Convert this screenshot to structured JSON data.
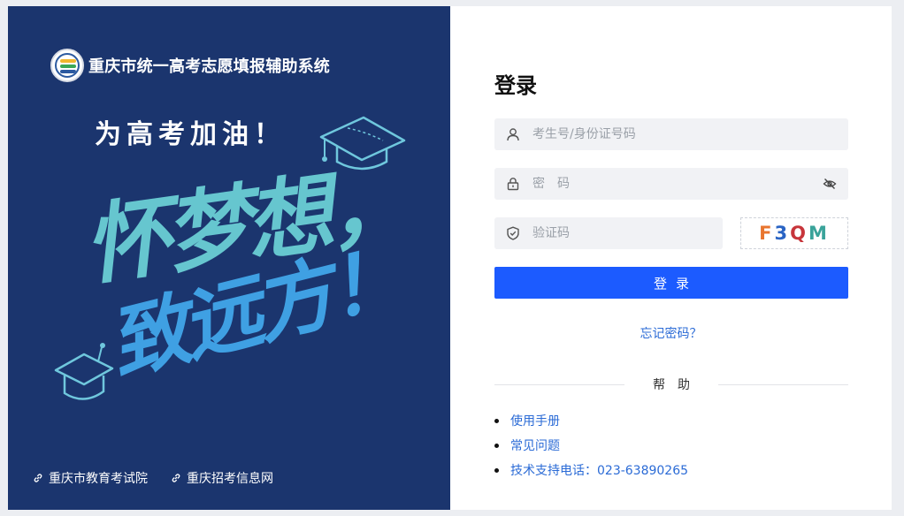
{
  "left": {
    "brand_title": "重庆市统一高考志愿填报辅助系统",
    "slogan": "为高考加油！",
    "calligraphy_line1": "怀梦想，",
    "calligraphy_line2": "致远方！",
    "links": [
      {
        "label": "重庆市教育考试院",
        "icon": "link-icon"
      },
      {
        "label": "重庆招考信息网",
        "icon": "link-icon"
      }
    ]
  },
  "login": {
    "title": "登录",
    "username_placeholder": "考生号/身份证号码",
    "password_placeholder": "密　码",
    "captcha_placeholder": "验证码",
    "captcha_chars": [
      "F",
      "3",
      "Q",
      "M"
    ],
    "button_label": "登录",
    "forgot_label": "忘记密码？"
  },
  "help": {
    "title": "帮助",
    "items": [
      "使用手册",
      "常见问题",
      "技术支持电话：023-63890265"
    ]
  },
  "colors": {
    "left_bg": "#1b356e",
    "primary": "#1c5bff",
    "link": "#2b6bd6"
  }
}
